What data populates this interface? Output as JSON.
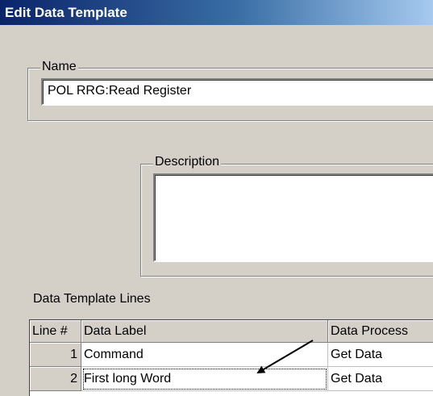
{
  "window": {
    "title": "Edit Data Template"
  },
  "name_group": {
    "legend": "Name",
    "value": "POL RRG:Read Register"
  },
  "description_group": {
    "legend": "Description",
    "value": ""
  },
  "lines_section": {
    "label": "Data Template Lines",
    "columns": [
      "Line #",
      "Data Label",
      "Data Process"
    ],
    "rows": [
      {
        "line": "1",
        "label": "Command",
        "process": "Get Data"
      },
      {
        "line": "2",
        "label": "First long Word",
        "process": "Get Data"
      }
    ]
  }
}
